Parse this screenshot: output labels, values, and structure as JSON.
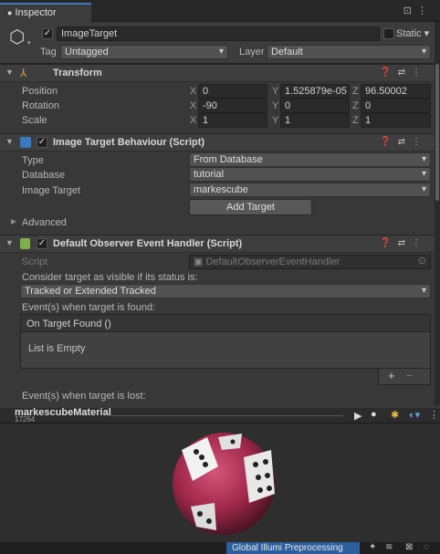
{
  "window": {
    "tab_title": "Inspector"
  },
  "object": {
    "name": "ImageTarget",
    "static_label": "Static",
    "tag_label": "Tag",
    "tag_value": "Untagged",
    "layer_label": "Layer",
    "layer_value": "Default"
  },
  "transform": {
    "title": "Transform",
    "position_label": "Position",
    "rotation_label": "Rotation",
    "scale_label": "Scale",
    "axis_x": "X",
    "axis_y": "Y",
    "axis_z": "Z",
    "position": {
      "x": "0",
      "y": "1.525879e-05",
      "z": "96.50002"
    },
    "rotation": {
      "x": "-90",
      "y": "0",
      "z": "0"
    },
    "scale": {
      "x": "1",
      "y": "1",
      "z": "1"
    }
  },
  "itb": {
    "title": "Image Target Behaviour (Script)",
    "type_label": "Type",
    "type_value": "From Database",
    "database_label": "Database",
    "database_value": "tutorial",
    "image_target_label": "Image Target",
    "image_target_value": "markescube",
    "add_target": "Add Target",
    "advanced": "Advanced"
  },
  "doeh": {
    "title": "Default Observer Event Handler (Script)",
    "script_label": "Script",
    "script_value": "DefaultObserverEventHandler",
    "consider_text": "Consider target as visible if its status is:",
    "status_value": "Tracked or Extended Tracked",
    "found_label": "Event(s) when target is found:",
    "found_header": "On Target Found ()",
    "list_empty": "List is Empty",
    "plus": "+",
    "minus": "−",
    "lost_label": "Event(s) when target is lost:"
  },
  "preview": {
    "material_name": "markescubeMaterial",
    "sub_text": "17264"
  },
  "statusbar": {
    "global_illum": "Global Illumi",
    "preprocessing": "Preprocessing"
  },
  "colors": {
    "accent_blue": "#3a79bb",
    "transform_icon": "#d9a53a",
    "script_icon": "#7fae4b"
  }
}
